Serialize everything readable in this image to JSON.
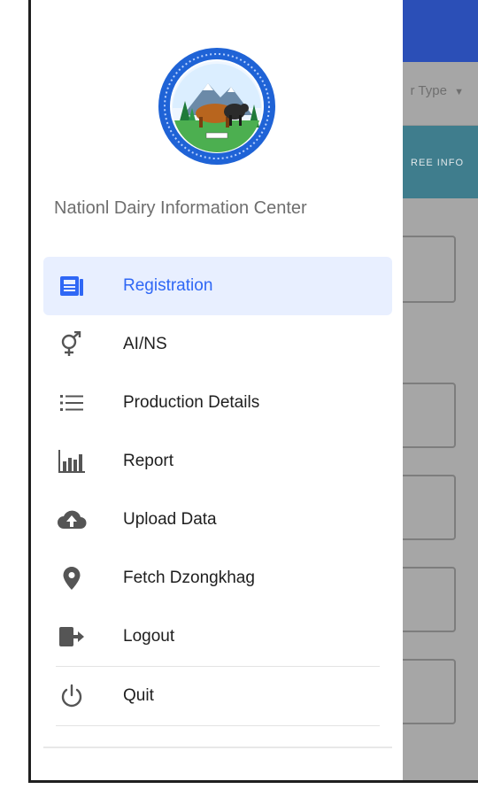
{
  "background": {
    "dropdown_label": "r Type",
    "tab_label": "REE INFO"
  },
  "drawer": {
    "center_name": "Nationl Dairy Information Center",
    "menu": [
      {
        "label": "Registration",
        "icon": "registration-icon",
        "selected": true
      },
      {
        "label": "AI/NS",
        "icon": "gender-icon",
        "selected": false
      },
      {
        "label": "Production Details",
        "icon": "list-icon",
        "selected": false
      },
      {
        "label": "Report",
        "icon": "bar-chart-icon",
        "selected": false
      },
      {
        "label": "Upload Data",
        "icon": "cloud-upload-icon",
        "selected": false
      },
      {
        "label": "Fetch Dzongkhag",
        "icon": "location-pin-icon",
        "selected": false
      },
      {
        "label": "Logout",
        "icon": "logout-icon",
        "selected": false
      },
      {
        "label": "Quit",
        "icon": "power-icon",
        "selected": false
      }
    ]
  },
  "colors": {
    "accent": "#2f67f5",
    "selected_bg": "#e8efff",
    "appbar": "#2b4fb7",
    "tabbar": "#3f7d8d"
  }
}
